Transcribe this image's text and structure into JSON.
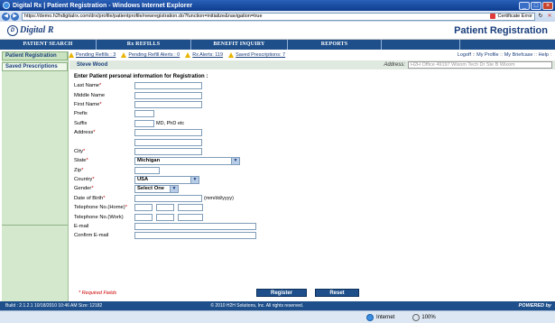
{
  "window": {
    "title": "Digital Rx | Patient Registration - Windows Internet Explorer",
    "url": "https://demo.h2hdigitalrx.com/drx/profile/patientprofile/newregistration.do?function=initialize&navigation=true",
    "cert_error": "Certificate Error"
  },
  "header": {
    "logo_text": "Digital R",
    "page_heading": "Patient Registration"
  },
  "menu": [
    "PATIENT SEARCH",
    "Rx REFILLS",
    "BENEFIT INQUIRY",
    "REPORTS",
    ""
  ],
  "alerts": [
    {
      "label": "Pending Refills : 3"
    },
    {
      "label": "Pending Refill Alerts : 0"
    },
    {
      "label": "Rx Alerts: 119"
    },
    {
      "label": "Saved Prescriptions: 7"
    }
  ],
  "toplinks": {
    "logoff": "Logoff",
    "profile": "My Profile",
    "briefcase": "My Briefcase",
    "help": "Help"
  },
  "sidebar": {
    "items": [
      {
        "label": "Patient Registration"
      },
      {
        "label": "Saved Prescriptions"
      }
    ]
  },
  "patient": {
    "name": "Steve Wood",
    "address_label": "Address:",
    "address_value": "H2H Office 49197 Wixom Tech Dr Ste B Wixom"
  },
  "form": {
    "title": "Enter Patient personal information for Registration :",
    "last_name": "Last Name",
    "middle_name": "Middle Name",
    "first_name": "First Name",
    "prefix": "Prefix",
    "suffix": "Suffix",
    "suffix_hint": "MD, PhD etc",
    "address": "Address",
    "city": "City",
    "state": "State",
    "state_value": "Michigan",
    "zip": "Zip",
    "country": "Country",
    "country_value": "USA",
    "gender": "Gender",
    "gender_value": "Select One",
    "dob": "Date of Birth",
    "dob_hint": "(mm/dd/yyyy)",
    "phone_home": "Telephone No.(Home)",
    "phone_work": "Telephone No.(Work)",
    "email": "E-mail",
    "confirm_email": "Confirm E-mail",
    "req_mark": "*"
  },
  "bottom": {
    "required_note": "* Required Fields",
    "register": "Register",
    "reset": "Reset"
  },
  "footer": {
    "build": "Build : 2.1.2.1 10/18/2010 10:46 AM  Size: 12182",
    "copyright": "© 2010 H2H Solutions, Inc. All rights reserved.",
    "powered": "POWERED by"
  },
  "status": {
    "zone": "Internet",
    "zoom": "100%"
  },
  "colors": {
    "brand": "#1e4f8a",
    "sidebar": "#d4e8cd",
    "required": "#cc0000"
  }
}
